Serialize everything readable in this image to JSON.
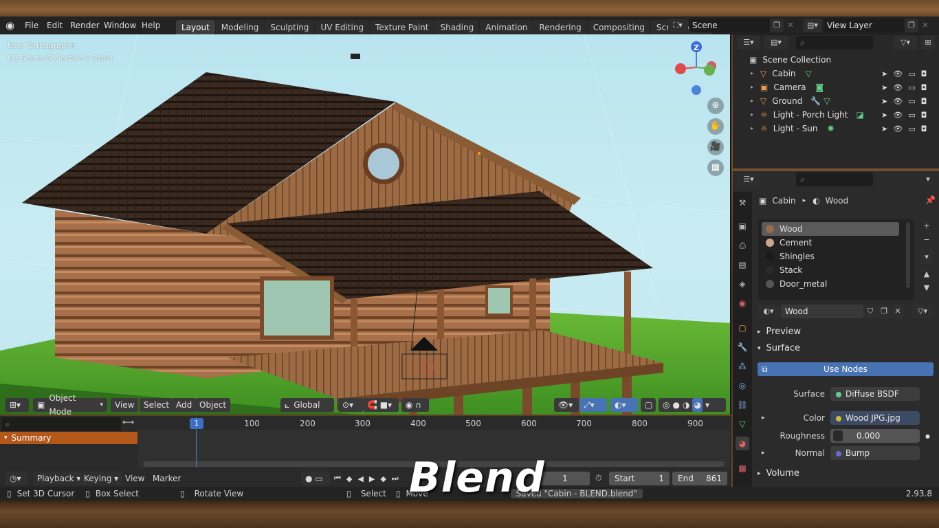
{
  "menu": [
    "File",
    "Edit",
    "Render",
    "Window",
    "Help"
  ],
  "workspaces": [
    "Layout",
    "Modeling",
    "Sculpting",
    "UV Editing",
    "Texture Paint",
    "Shading",
    "Animation",
    "Rendering",
    "Compositing",
    "Scripting"
  ],
  "active_workspace": "Layout",
  "scene_name": "Scene",
  "view_layer": "View Layer",
  "viewport": {
    "view_name": "User Orthographic",
    "collection_info": "(1) Scene Collection | Cabin",
    "mode": "Object Mode",
    "menus": [
      "View",
      "Select",
      "Add",
      "Object"
    ],
    "transform_orientation": "Global",
    "gizmo_axis": "Z"
  },
  "outliner": {
    "root": "Scene Collection",
    "items": [
      {
        "name": "Cabin"
      },
      {
        "name": "Camera"
      },
      {
        "name": "Ground"
      },
      {
        "name": "Light - Porch Light"
      },
      {
        "name": "Light - Sun"
      }
    ]
  },
  "properties": {
    "breadcrumb_object": "Cabin",
    "breadcrumb_material": "Wood",
    "material_slots": [
      {
        "name": "Wood",
        "color": "#9a6a45"
      },
      {
        "name": "Cement",
        "color": "#c9a58a"
      },
      {
        "name": "Shingles",
        "color": "#1a1a1a"
      },
      {
        "name": "Stack",
        "color": "#2a2a2a"
      },
      {
        "name": "Door_metal",
        "color": "#555555"
      }
    ],
    "material_name": "Wood",
    "panels": {
      "preview": "Preview",
      "surface": "Surface",
      "volume": "Volume"
    },
    "use_nodes_label": "Use Nodes",
    "surface": {
      "surface_label": "Surface",
      "surface_value": "Diffuse BSDF",
      "color_label": "Color",
      "color_value": "Wood JPG.jpg",
      "roughness_label": "Roughness",
      "roughness_value": "0.000",
      "normal_label": "Normal",
      "normal_value": "Bump"
    }
  },
  "timeline": {
    "ticks": [
      "1",
      "100",
      "200",
      "300",
      "400",
      "500",
      "600",
      "700",
      "800",
      "900"
    ],
    "summary": "Summary",
    "menus": [
      "Playback",
      "Keying",
      "View",
      "Marker"
    ],
    "current_frame": "1",
    "start_label": "Start",
    "start_value": "1",
    "end_label": "End",
    "end_value": "861"
  },
  "status": {
    "set_cursor": "Set 3D Cursor",
    "box_select": "Box Select",
    "rotate_view": "Rotate View",
    "select": "Select",
    "move": "Move",
    "saved_message": "Saved \"Cabin - BLEND.blend\"",
    "version": "2.93.8"
  },
  "watermark": "Blend"
}
